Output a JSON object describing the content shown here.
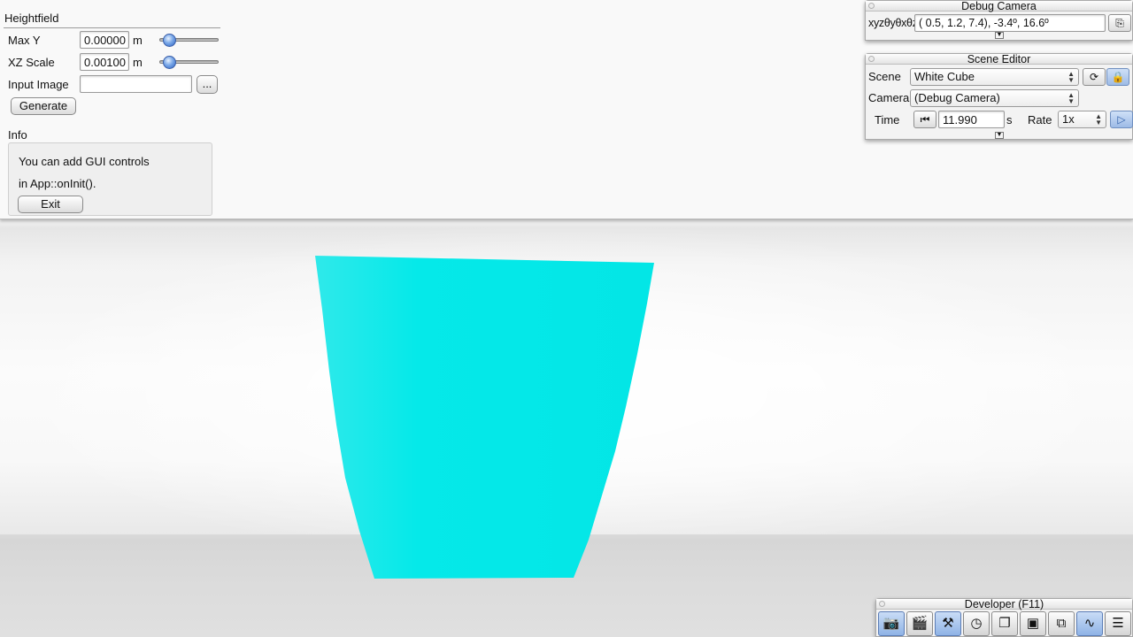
{
  "heightfield": {
    "title": "Heightfield",
    "max_y": {
      "label": "Max Y",
      "value": "0.00000",
      "unit": "m",
      "slider_fraction": 0.08
    },
    "xz_scale": {
      "label": "XZ Scale",
      "value": "0.00100",
      "unit": "m",
      "slider_fraction": 0.08
    },
    "input_image": {
      "label": "Input Image",
      "value": "",
      "browse_label": "..."
    },
    "generate_label": "Generate"
  },
  "info": {
    "title": "Info",
    "line1": "You can add GUI controls",
    "line2": "in App::onInit().",
    "exit_label": "Exit"
  },
  "debug_camera": {
    "title": "Debug Camera",
    "coord_label": "xyzθyθxθz",
    "coords": "(  0.5,   1.2,   7.4),  -3.4º,  16.6º",
    "icon": "copy-frame-icon"
  },
  "scene_editor": {
    "title": "Scene Editor",
    "scene_label": "Scene",
    "scene_value": "White Cube",
    "camera_label": "Camera",
    "camera_value": "(Debug Camera)",
    "time_label": "Time",
    "time_value": "11.990",
    "time_unit": "s",
    "rate_label": "Rate",
    "rate_value": "1x",
    "reload_symbol": "⟳",
    "icons": [
      "reload-icon",
      "lock-icon",
      "reset-time-icon",
      "play-icon"
    ]
  },
  "developer": {
    "title": "Developer (F11)",
    "tools": [
      {
        "name": "camera-icon",
        "glyph": "📷"
      },
      {
        "name": "film-clapper-icon",
        "glyph": "🎬"
      },
      {
        "name": "tools-icon",
        "glyph": "⚒"
      },
      {
        "name": "clock-icon",
        "glyph": "◷"
      },
      {
        "name": "new-window-icon",
        "glyph": "❐"
      },
      {
        "name": "terminal-icon",
        "glyph": "▣"
      },
      {
        "name": "windows-icon",
        "glyph": "⧉"
      },
      {
        "name": "profiler-icon",
        "glyph": "∿"
      },
      {
        "name": "log-icon",
        "glyph": "☰"
      }
    ]
  },
  "colors": {
    "cube": "#05e9e9",
    "accent": "#3a6fd0"
  }
}
